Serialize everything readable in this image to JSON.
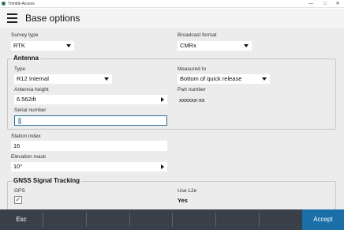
{
  "window": {
    "title": "Trimble Access",
    "minimize": "—",
    "maximize": "□",
    "close": "✕"
  },
  "header": {
    "title": "Base options",
    "menu_icon": "hamburger-menu-icon"
  },
  "survey_type": {
    "label": "Survey type",
    "value": "RTK"
  },
  "broadcast_format": {
    "label": "Broadcast format",
    "value": "CMRx"
  },
  "antenna": {
    "group_title": "Antenna",
    "type": {
      "label": "Type",
      "value": "R12 Internal"
    },
    "measured_to": {
      "label": "Measured to",
      "value": "Bottom of quick release"
    },
    "height": {
      "label": "Antenna height",
      "value": "6.562ift"
    },
    "part_number": {
      "label": "Part number",
      "value": "xxxxxx-xx"
    },
    "serial_number": {
      "label": "Serial number",
      "value": ""
    }
  },
  "station_index": {
    "label": "Station index",
    "value": "16"
  },
  "elevation_mask": {
    "label": "Elevation mask",
    "value": "10°"
  },
  "gnss": {
    "group_title": "GNSS Signal Tracking",
    "gps": {
      "label": "GPS",
      "checked": true,
      "check_glyph": "✓"
    },
    "use_l2e": {
      "label": "Use L2e",
      "value": "Yes"
    }
  },
  "bottom_bar": {
    "esc_label": "Esc",
    "accept_label": "Accept"
  },
  "colors": {
    "accent": "#1b6fa8",
    "bottom_bar": "#39404a",
    "focus_border": "#2a6f97"
  }
}
